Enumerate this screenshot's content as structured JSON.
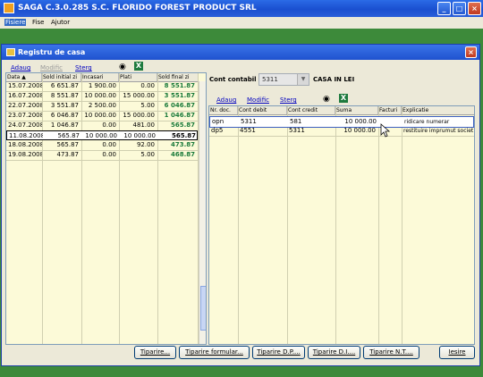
{
  "app": {
    "title": "SAGA C.3.0.285   S.C. FLORIDO FOREST PRODUCT SRL"
  },
  "menu": [
    "Fisiere",
    "Fise",
    "Ajutor"
  ],
  "dialog": {
    "title": "Registru de casa"
  },
  "left_toolbar": {
    "add": "Adaug",
    "edit": "Modific",
    "delete": "Sterg"
  },
  "right_toolbar": {
    "add": "Adaug",
    "edit": "Modific",
    "delete": "Sterg"
  },
  "cont": {
    "label": "Cont contabil",
    "value": "5311",
    "description": "CASA IN LEI"
  },
  "left_table": {
    "headers": [
      "Data ▲",
      "Sold initial zi",
      "Incasari",
      "Plati",
      "Sold final zi"
    ],
    "rows": [
      [
        "15.07.2008",
        "6 651.87",
        "1 900.00",
        "0.00",
        "8 551.87"
      ],
      [
        "16.07.2008",
        "8 551.87",
        "10 000.00",
        "15 000.00",
        "3 551.87"
      ],
      [
        "22.07.2008",
        "3 551.87",
        "2 500.00",
        "5.00",
        "6 046.87"
      ],
      [
        "23.07.2008",
        "6 046.87",
        "10 000.00",
        "15 000.00",
        "1 046.87"
      ],
      [
        "24.07.2008",
        "1 046.87",
        "0.00",
        "481.00",
        "565.87"
      ],
      [
        "11.08.2008",
        "565.87",
        "10 000.00",
        "10 000.00",
        "565.87"
      ],
      [
        "18.08.2008",
        "565.87",
        "0.00",
        "92.00",
        "473.87"
      ],
      [
        "19.08.2008",
        "473.87",
        "0.00",
        "5.00",
        "468.87"
      ]
    ]
  },
  "right_table": {
    "headers": [
      "Nr. doc.",
      "Cont debit",
      "Cont credit",
      "Suma",
      "Facturi",
      "Explicatie"
    ],
    "rows": [
      [
        "opn",
        "5311",
        "581",
        "10 000.00",
        "",
        "ridicare numerar"
      ],
      [
        "dp5",
        "4551",
        "5311",
        "10 000.00",
        "",
        "restituire imprumut societ"
      ]
    ]
  },
  "buttons": [
    "Tiparire...",
    "Tiparire formular...",
    "Tiparire D.P....",
    "Tiparire D.I....",
    "Tiparire N.T....",
    "Iesire"
  ],
  "colors": {
    "final_balance_green": "#1a7a3a",
    "selection": "#316ac5",
    "grid_bg": "#fcfad8"
  }
}
